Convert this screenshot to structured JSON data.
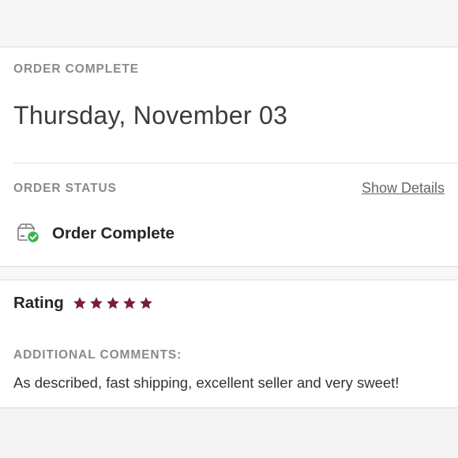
{
  "order": {
    "eyebrow": "ORDER COMPLETE",
    "date": "Thursday, November 03",
    "status_eyebrow": "ORDER STATUS",
    "show_details_label": "Show Details",
    "status_text": "Order Complete",
    "status_icon": "box-check-icon"
  },
  "rating": {
    "label": "Rating",
    "stars": 5,
    "max_stars": 5,
    "star_color": "#7a1f33",
    "comments_label": "ADDITIONAL COMMENTS:",
    "comments_text": "As described, fast shipping, excellent seller and very sweet!"
  },
  "colors": {
    "check_green": "#3bb54a",
    "muted_text": "#8a8a8a"
  }
}
